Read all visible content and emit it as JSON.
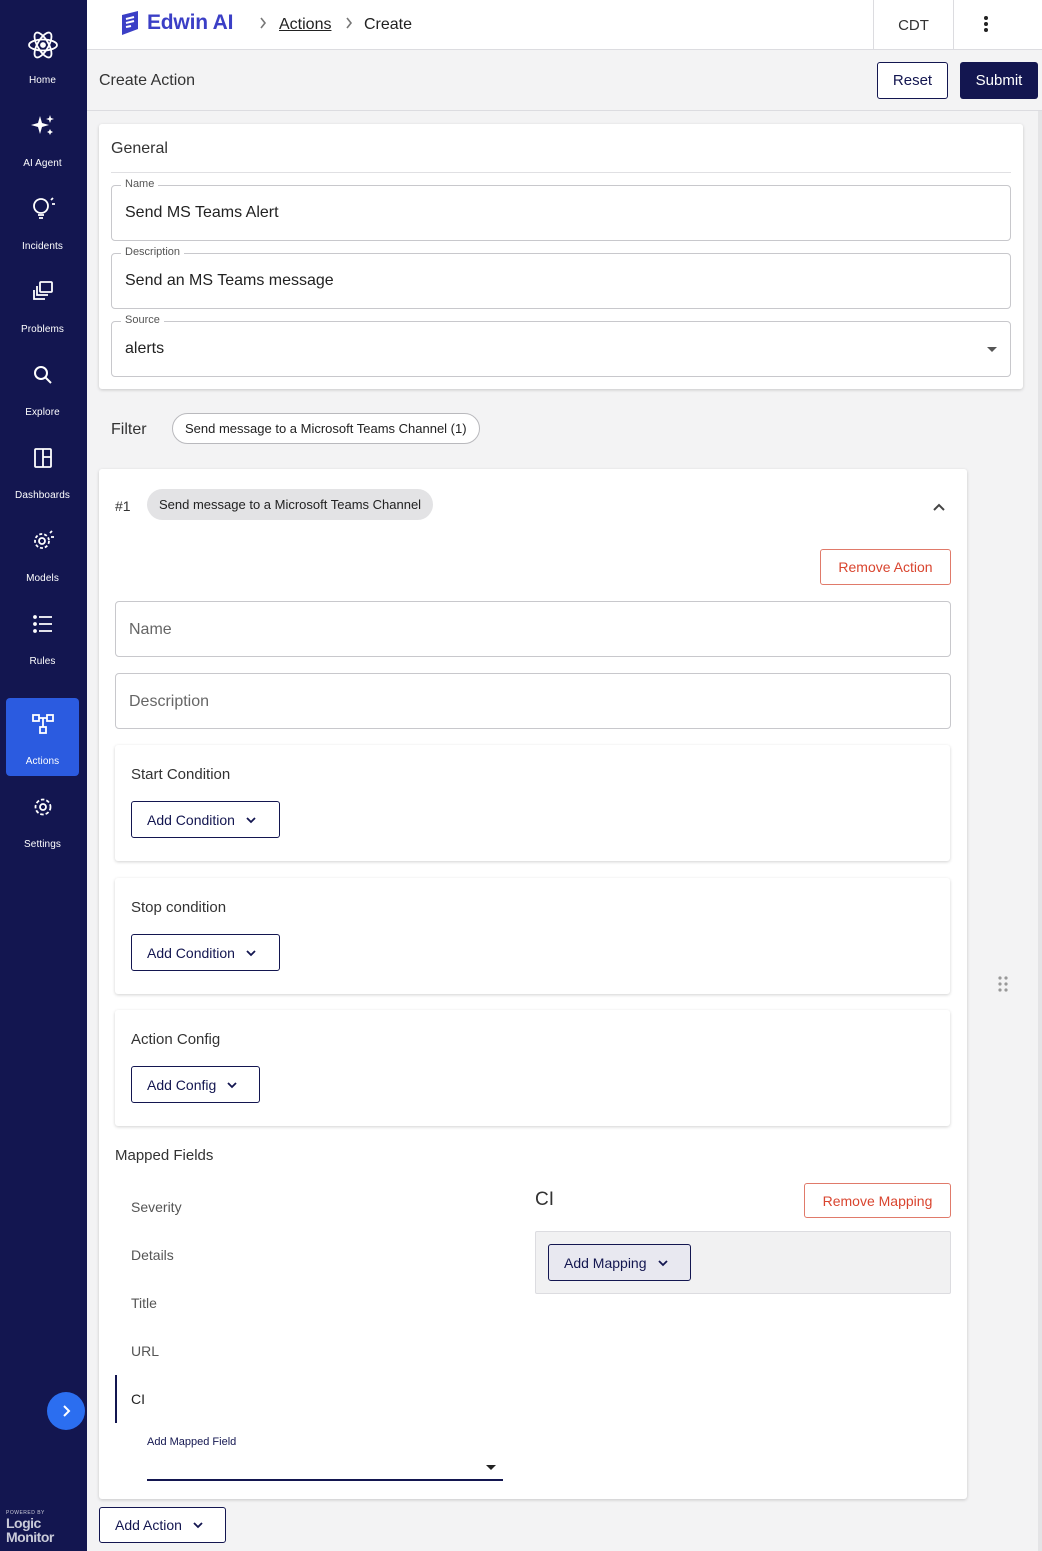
{
  "sidebar": {
    "items": [
      {
        "label": "Home",
        "icon": "atom-icon"
      },
      {
        "label": "AI Agent",
        "icon": "sparkles-icon"
      },
      {
        "label": "Incidents",
        "icon": "lightbulb-icon"
      },
      {
        "label": "Problems",
        "icon": "stack-icon"
      },
      {
        "label": "Explore",
        "icon": "search-icon"
      },
      {
        "label": "Dashboards",
        "icon": "layout-icon"
      },
      {
        "label": "Models",
        "icon": "gear-cog-icon"
      },
      {
        "label": "Rules",
        "icon": "list-icon"
      },
      {
        "label": "Actions",
        "icon": "flow-icon"
      },
      {
        "label": "Settings",
        "icon": "settings-icon"
      }
    ],
    "active": "Actions",
    "powered_by": "POWERED BY",
    "brand_line1": "Logic",
    "brand_line2": "Monitor"
  },
  "topbar": {
    "logo_text": "Edwin AI",
    "breadcrumb": [
      "Actions",
      "Create"
    ],
    "timezone": "CDT"
  },
  "subheader": {
    "title": "Create Action",
    "reset_label": "Reset",
    "submit_label": "Submit"
  },
  "general": {
    "title": "General",
    "name_label": "Name",
    "name_value": "Send MS Teams Alert",
    "description_label": "Description",
    "description_value": "Send an MS Teams message",
    "source_label": "Source",
    "source_value": "alerts"
  },
  "filter": {
    "label": "Filter",
    "chip": "Send message to a Microsoft Teams Channel (1)"
  },
  "action": {
    "index": "#1",
    "chip": "Send message to a Microsoft Teams Channel",
    "remove_label": "Remove Action",
    "name_placeholder": "Name",
    "description_placeholder": "Description",
    "start_condition": {
      "title": "Start Condition",
      "button": "Add Condition"
    },
    "stop_condition": {
      "title": "Stop condition",
      "button": "Add Condition"
    },
    "action_config": {
      "title": "Action Config",
      "button": "Add Config"
    },
    "mapped_fields": {
      "title": "Mapped Fields",
      "items": [
        "Severity",
        "Details",
        "Title",
        "URL",
        "CI"
      ],
      "selected": "CI",
      "add_field_label": "Add Mapped Field",
      "detail_title": "CI",
      "remove_mapping_label": "Remove Mapping",
      "add_mapping_label": "Add Mapping"
    }
  },
  "footer": {
    "add_action_label": "Add Action"
  },
  "colors": {
    "sidebar_bg": "#131650",
    "active_nav": "#2b5be0",
    "primary": "#131650",
    "brand": "#3b3fc6",
    "danger": "#d9452f"
  }
}
